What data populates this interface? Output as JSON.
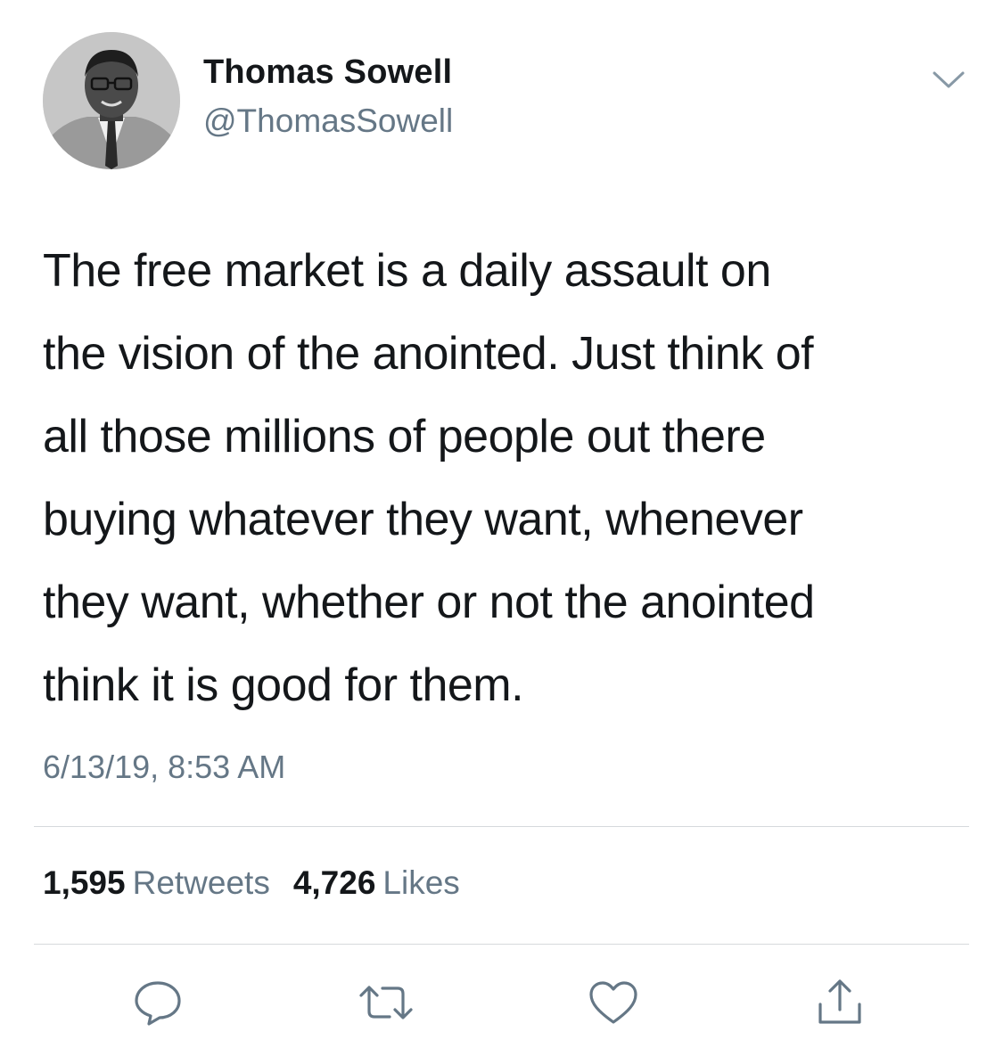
{
  "tweet": {
    "display_name": "Thomas Sowell",
    "handle": "@ThomasSowell",
    "text_lines": [
      "The free market is a daily assault on",
      "the vision of the anointed. Just think of",
      "all those millions of people out there",
      "buying whatever they want, whenever",
      "they want, whether or not the anointed",
      "think it is good for them."
    ],
    "timestamp": "6/13/19, 8:53 AM",
    "retweet_count": "1,595",
    "retweet_label": "Retweets",
    "like_count": "4,726",
    "like_label": "Likes"
  },
  "icons": {
    "menu": "chevron-down-icon",
    "reply": "reply-icon",
    "retweet": "retweet-icon",
    "like": "heart-icon",
    "share": "share-icon"
  },
  "colors": {
    "primary_text": "#14171a",
    "secondary_text": "#657786",
    "divider": "#d6d9dc"
  }
}
